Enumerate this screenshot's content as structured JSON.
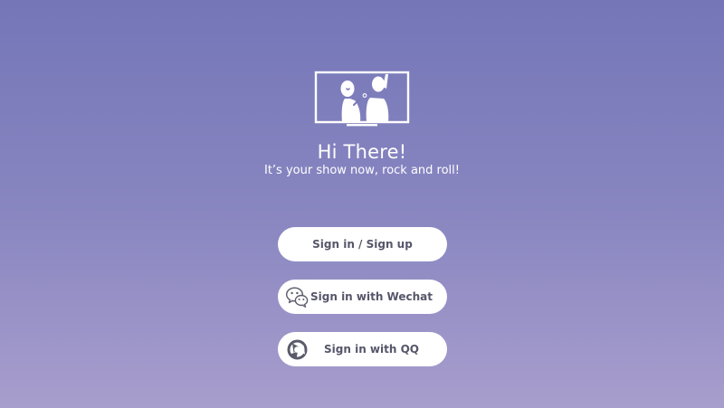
{
  "hero": {
    "title": "Hi There!",
    "subtitle": "It’s your show now, rock and roll!",
    "logo_icon": "tv-singers-icon"
  },
  "buttons": {
    "signin": {
      "label": "Sign in / Sign up"
    },
    "wechat": {
      "label": "Sign in with Wechat",
      "icon": "wechat-icon"
    },
    "qq": {
      "label": "Sign in with QQ",
      "icon": "qq-icon"
    }
  },
  "colors": {
    "background_top": "#7476b8",
    "background_bottom": "#a89ecd",
    "button_bg": "#ffffff",
    "button_text": "#56566a"
  }
}
